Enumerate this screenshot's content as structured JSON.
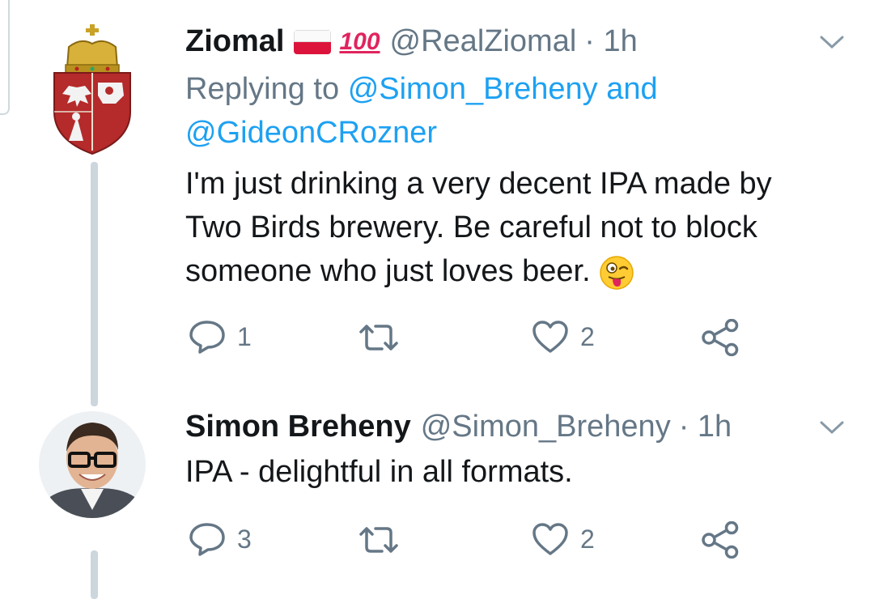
{
  "tweets": [
    {
      "name": "Ziomal",
      "badge": "💯",
      "handle": "@RealZiomal",
      "time": "· 1h",
      "replying_label": "Replying to",
      "mention_1": "@Simon_Breheny",
      "joiner": "and",
      "mention_2": "@GideonCRozner",
      "line_1": "I'm just drinking a very decent IPA made by",
      "line_2": "Two Birds brewery. Be careful not to block",
      "line_3": "someone who just loves beer.",
      "emoji": "winking-face-with-tongue",
      "replies": "1",
      "retweets": "",
      "likes": "2"
    },
    {
      "name": "Simon Breheny",
      "handle": "@Simon_Breheny",
      "time": "· 1h",
      "line_1": "IPA - delightful in all formats.",
      "replies": "3",
      "retweets": "",
      "likes": "2"
    }
  ],
  "colors": {
    "link": "#1da1f2",
    "meta": "#657786",
    "thread": "#ccd6dd"
  }
}
